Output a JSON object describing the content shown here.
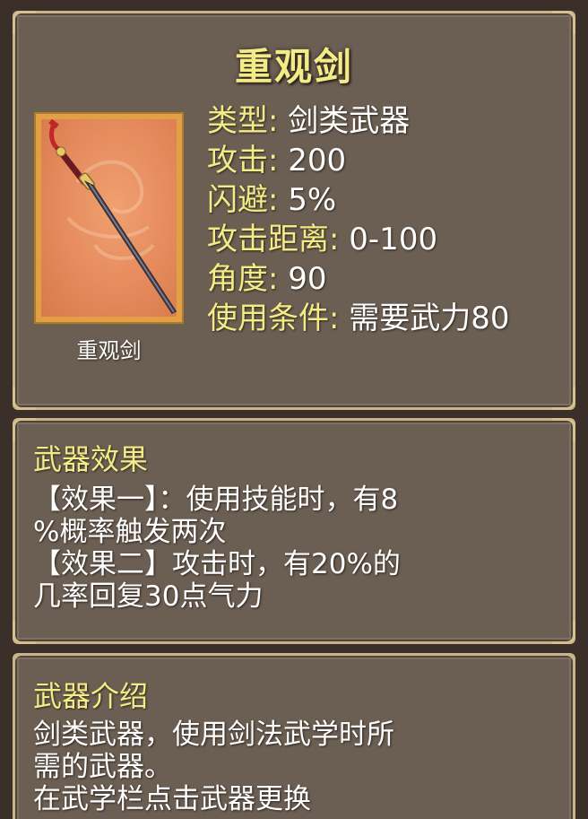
{
  "item": {
    "title": "重观剑",
    "name_caption": "重观剑",
    "icon": "sword-icon"
  },
  "stats": [
    {
      "label": "类型",
      "value": "剑类武器"
    },
    {
      "label": "攻击",
      "value": "200"
    },
    {
      "label": "闪避",
      "value": "5%"
    },
    {
      "label": "攻击距离",
      "value": "0-100"
    },
    {
      "label": "角度",
      "value": "90"
    },
    {
      "label": "使用条件",
      "value": "需要武力80"
    }
  ],
  "colon": ":",
  "effect": {
    "title": "武器效果",
    "lines": [
      "【效果一】：使用技能时，有8",
      "%概率触发两次",
      "【效果二】攻击时，有20%的",
      "几率回复30点气力"
    ]
  },
  "intro": {
    "title": "武器介绍",
    "lines": [
      "剑类武器，使用剑法武学时所",
      "需的武器。",
      "在武学栏点击武器更换"
    ]
  },
  "colors": {
    "panel": "#6b5e52",
    "border": "#c9b38a",
    "label": "#f3ec86",
    "value": "#ffffff",
    "frame": "#e0a043"
  }
}
